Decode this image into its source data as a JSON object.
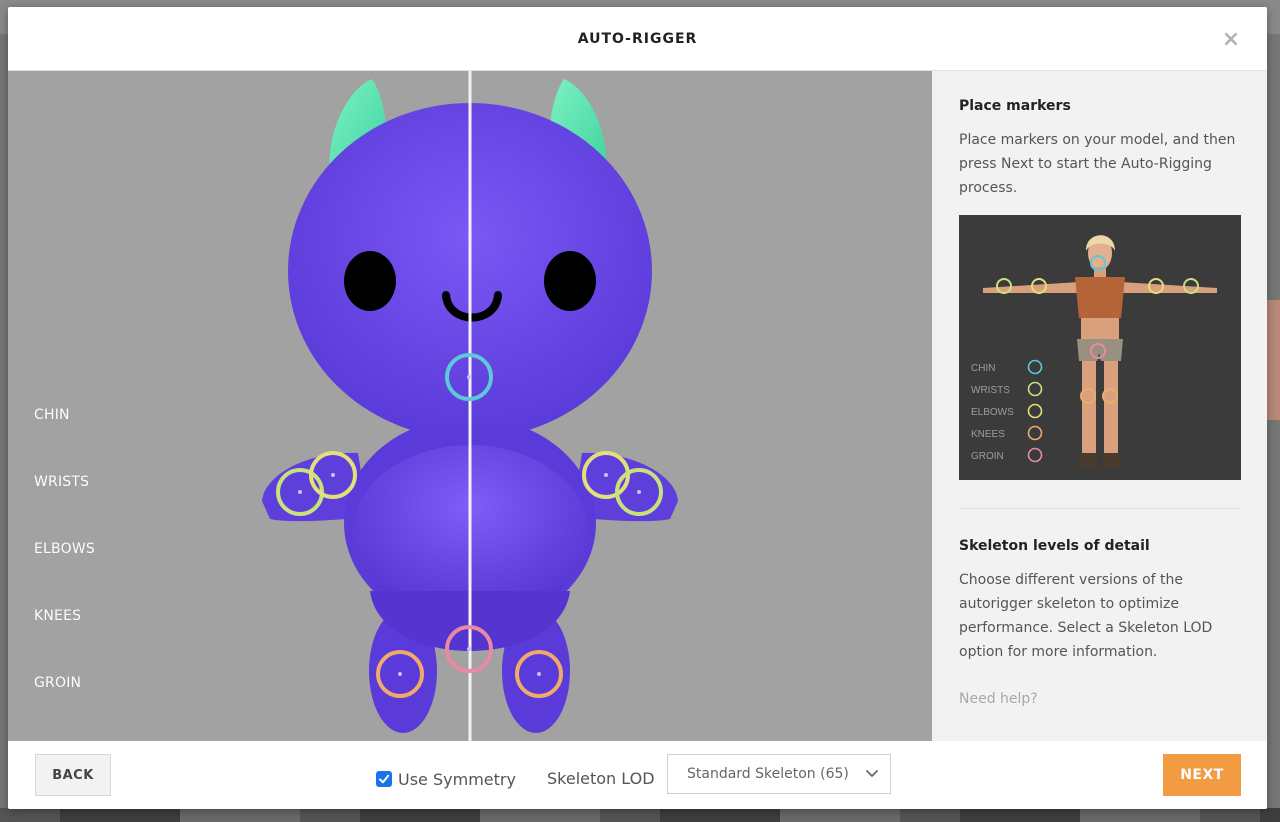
{
  "modal": {
    "title": "AUTO-RIGGER",
    "close_icon": "×"
  },
  "viewport": {
    "marker_labels": [
      "CHIN",
      "WRISTS",
      "ELBOWS",
      "KNEES",
      "GROIN"
    ],
    "colors": {
      "background": "#a2a2a2",
      "body": "#6f4df0",
      "horns": "#5fe8b0",
      "chin": "#5cc8d8",
      "wrists": "#c8e27a",
      "elbows": "#e2e07a",
      "knees": "#eeab6a",
      "groin": "#e98aa4"
    }
  },
  "sidebar": {
    "place_title": "Place markers",
    "place_text": "Place markers on your model, and then press Next to start the Auto-Rigging process.",
    "ref_legend": [
      "CHIN",
      "WRISTS",
      "ELBOWS",
      "KNEES",
      "GROIN"
    ],
    "lod_title": "Skeleton levels of detail",
    "lod_text": "Choose different versions of the autorigger skeleton to optimize performance. Select a Skeleton LOD option for more information.",
    "help_link": "Need help?"
  },
  "footer": {
    "back_label": "BACK",
    "symmetry_label": "Use Symmetry",
    "symmetry_checked": true,
    "lod_label": "Skeleton LOD",
    "lod_value": "Standard Skeleton (65)",
    "next_label": "NEXT",
    "accent_color": "#f29b43"
  }
}
